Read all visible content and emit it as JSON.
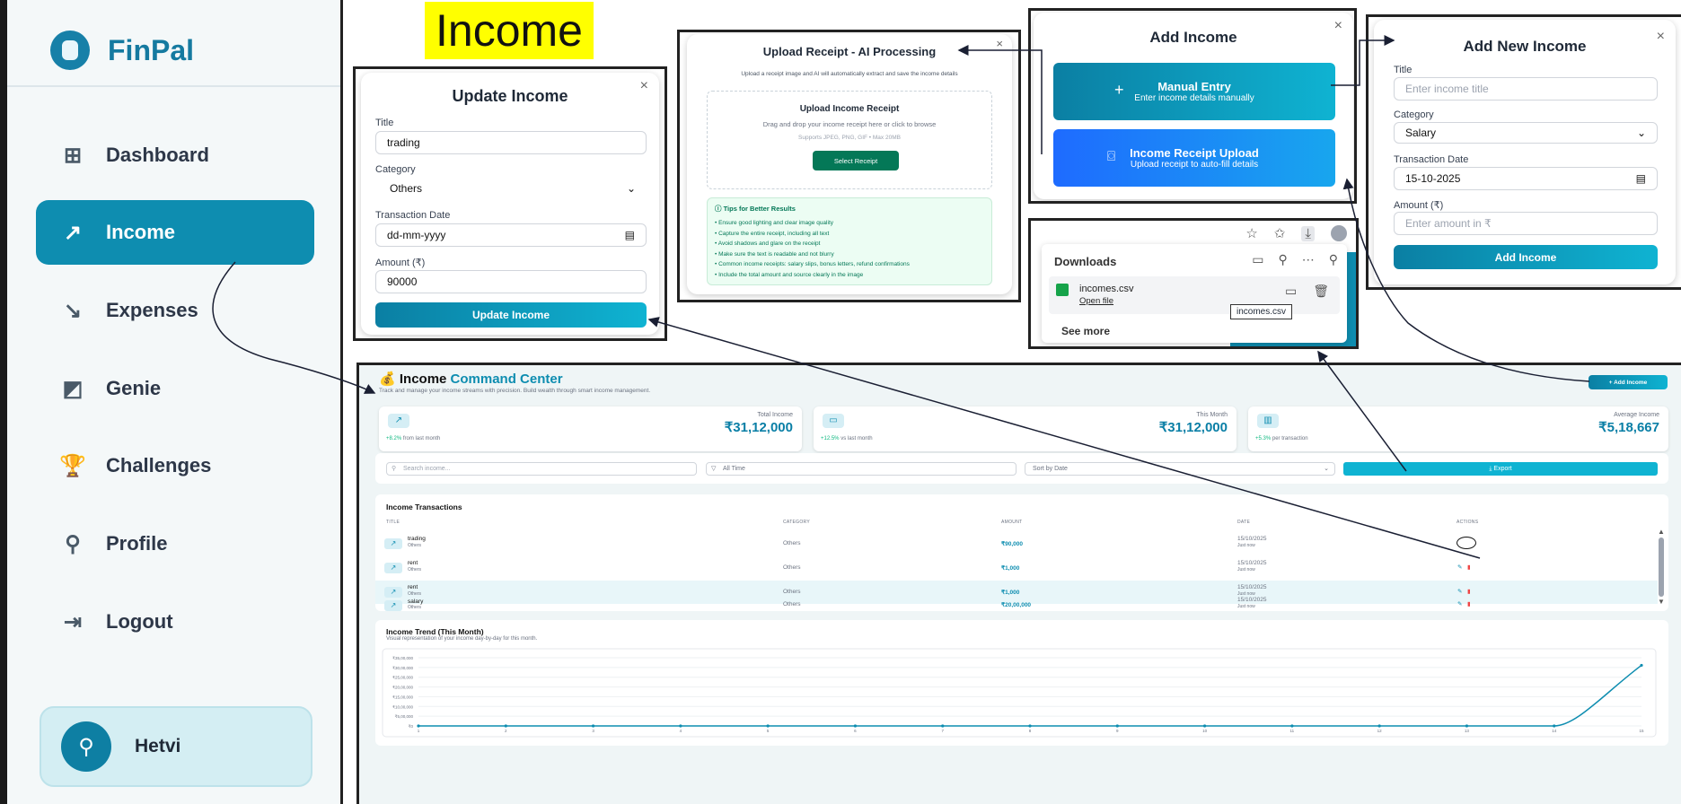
{
  "sidebar": {
    "logo": "FinPal",
    "items": [
      {
        "label": "Dashboard",
        "icon": "dashboard-icon",
        "glyph": "⊞"
      },
      {
        "label": "Income",
        "icon": "trend-up-icon",
        "glyph": "↗"
      },
      {
        "label": "Expenses",
        "icon": "trend-down-icon",
        "glyph": "↘"
      },
      {
        "label": "Genie",
        "icon": "genie-icon",
        "glyph": "◩"
      },
      {
        "label": "Challenges",
        "icon": "trophy-icon",
        "glyph": "🏆"
      },
      {
        "label": "Profile",
        "icon": "user-icon",
        "glyph": "⚲"
      },
      {
        "label": "Logout",
        "icon": "logout-icon",
        "glyph": "⇥"
      }
    ],
    "user": "Hetvi"
  },
  "annotation_title": "Income",
  "update_modal": {
    "title": "Update Income",
    "close": "×",
    "title_label": "Title",
    "title_value": "trading",
    "category_label": "Category",
    "category_value": "Others",
    "date_label": "Transaction Date",
    "date_value": "dd-mm-yyyy",
    "amount_label": "Amount (₹)",
    "amount_value": "90000",
    "submit": "Update Income"
  },
  "upload_modal": {
    "title": "Upload Receipt - AI Processing",
    "close": "×",
    "subtitle": "Upload a receipt image and AI will automatically extract and save the income details",
    "drop_title": "Upload Income Receipt",
    "drop_hint": "Drag and drop your income receipt here or click to browse",
    "drop_formats": "Supports JPEG, PNG, GIF • Max 20MB",
    "select_button": "Select Receipt",
    "tips_title": "Tips for Better Results",
    "tips": [
      "• Ensure good lighting and clear image quality",
      "• Capture the entire receipt, including all text",
      "• Avoid shadows and glare on the receipt",
      "• Make sure the text is readable and not blurry",
      "• Common income receipts: salary slips, bonus letters, refund confirmations",
      "• Include the total amount and source clearly in the image"
    ]
  },
  "add_income_modal": {
    "title": "Add Income",
    "close": "×",
    "manual_title": "Manual Entry",
    "manual_sub": "Enter income details manually",
    "manual_glyph": "+",
    "upload_title": "Income Receipt Upload",
    "upload_sub": "Upload receipt to auto-fill details"
  },
  "add_new_modal": {
    "title": "Add New Income",
    "close": "×",
    "title_label": "Title",
    "title_placeholder": "Enter income title",
    "category_label": "Category",
    "category_value": "Salary",
    "date_label": "Transaction Date",
    "date_value": "15-10-2025",
    "amount_label": "Amount (₹)",
    "amount_placeholder": "Enter amount in ₹",
    "submit": "Add Income"
  },
  "downloads": {
    "title": "Downloads",
    "file": "incomes.csv",
    "open": "Open file",
    "see_more": "See more",
    "tooltip": "incomes.csv",
    "behind": "+  Add Income"
  },
  "dashboard": {
    "title_a": "Income",
    "title_b": "Command Center",
    "subtitle": "Track and manage your income streams with precision. Build wealth through smart income management.",
    "add_button": "+  Add Income",
    "stats": [
      {
        "label": "Total Income",
        "value": "₹31,12,000",
        "change": "+8.2%",
        "suffix": "from last month",
        "icon": "trend-up-icon",
        "glyph": "↗"
      },
      {
        "label": "This Month",
        "value": "₹31,12,000",
        "change": "+12.5%",
        "suffix": "vs last month",
        "icon": "wallet-icon",
        "glyph": "▭"
      },
      {
        "label": "Average Income",
        "value": "₹5,18,667",
        "change": "+5.3%",
        "suffix": "per transaction",
        "icon": "bar-chart-icon",
        "glyph": "▥"
      }
    ],
    "search_placeholder": "Search income...",
    "period": "All Time",
    "sort": "Sort by Date",
    "export": "⤓  Export",
    "table_title": "Income Transactions",
    "columns": [
      "TITLE",
      "CATEGORY",
      "AMOUNT",
      "DATE",
      "ACTIONS"
    ],
    "rows": [
      {
        "title": "trading",
        "sub": "Others",
        "category": "Others",
        "amount": "₹90,000",
        "date": "15/10/2025",
        "when": "Just now"
      },
      {
        "title": "rent",
        "sub": "Others",
        "category": "Others",
        "amount": "₹1,000",
        "date": "15/10/2025",
        "when": "Just now"
      },
      {
        "title": "rent",
        "sub": "Others",
        "category": "Others",
        "amount": "₹1,000",
        "date": "15/10/2025",
        "when": "Just now"
      },
      {
        "title": "salary",
        "sub": "Others",
        "category": "Others",
        "amount": "₹20,00,000",
        "date": "15/10/2025",
        "when": "Just now"
      }
    ],
    "trend_title": "Income Trend (This Month)",
    "trend_sub": "Visual representation of your income day-by-day for this month."
  },
  "chart_data": {
    "type": "line",
    "title": "Income Trend (This Month)",
    "x": [
      1,
      2,
      3,
      4,
      5,
      6,
      7,
      8,
      9,
      10,
      11,
      12,
      13,
      14,
      15
    ],
    "series": [
      {
        "values": [
          0,
          0,
          0,
          0,
          0,
          0,
          0,
          0,
          0,
          0,
          0,
          0,
          0,
          0,
          3112000
        ]
      }
    ],
    "yticks": [
      "₹0",
      "₹5,00,000",
      "₹10,00,000",
      "₹15,00,000",
      "₹20,00,000",
      "₹25,00,000",
      "₹30,00,000",
      "₹35,00,000"
    ],
    "ylim": [
      0,
      3500000
    ],
    "grid": true,
    "colors": {
      "line": "#0e8db0"
    }
  }
}
